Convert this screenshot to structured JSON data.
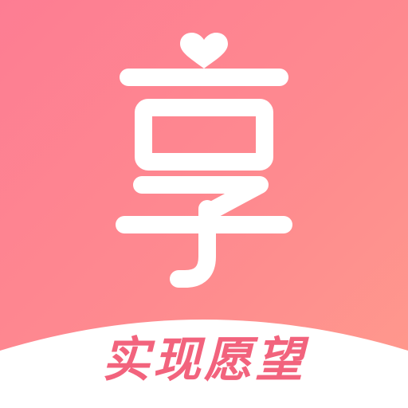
{
  "app_icon": {
    "slogan": "实现愿望",
    "colors": {
      "background_start": "#fd7d93",
      "background_end": "#ff9a8c",
      "glyph": "#ffffff",
      "slogan": "#f2637d",
      "band": "#ffffff"
    },
    "icons": [
      "heart-icon",
      "xiang-character-logo"
    ]
  }
}
